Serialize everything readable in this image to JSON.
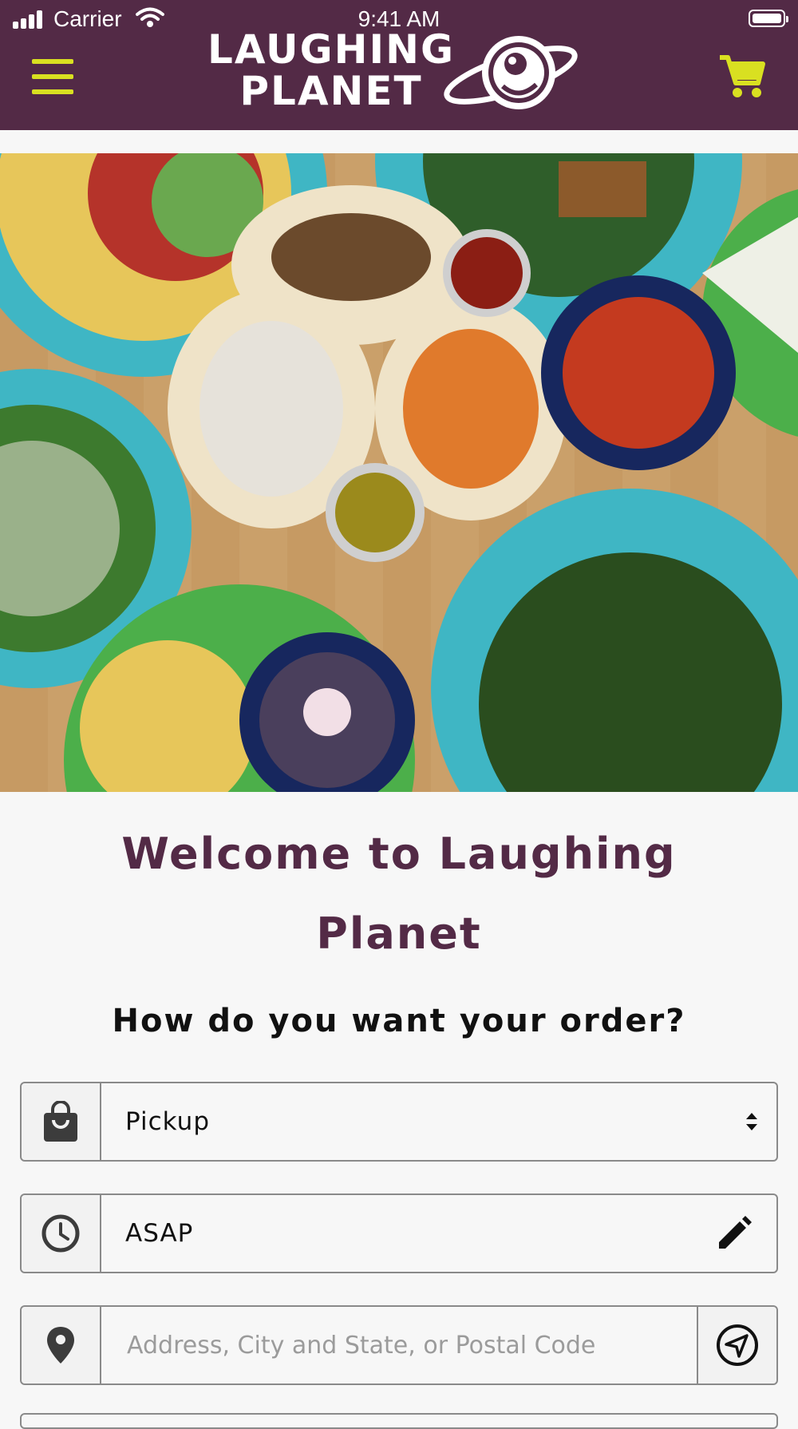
{
  "status_bar": {
    "carrier": "Carrier",
    "time": "9:41 AM"
  },
  "header": {
    "logo_line1": "LAUGHING",
    "logo_line2": "PLANET",
    "menu_icon": "hamburger-menu-icon",
    "cart_icon": "shopping-cart-icon",
    "background_color": "#532a46",
    "accent_color": "#d9e021"
  },
  "main": {
    "welcome_title": "Welcome to Laughing Planet",
    "order_question": "How do you want your order?"
  },
  "order_form": {
    "method": {
      "icon": "shopping-bag-icon",
      "value": "Pickup"
    },
    "time": {
      "icon": "clock-icon",
      "value": "ASAP",
      "edit_icon": "pencil-icon"
    },
    "location": {
      "icon": "map-pin-icon",
      "placeholder": "Address, City and State, or Postal Code",
      "locate_icon": "navigation-arrow-icon"
    }
  }
}
